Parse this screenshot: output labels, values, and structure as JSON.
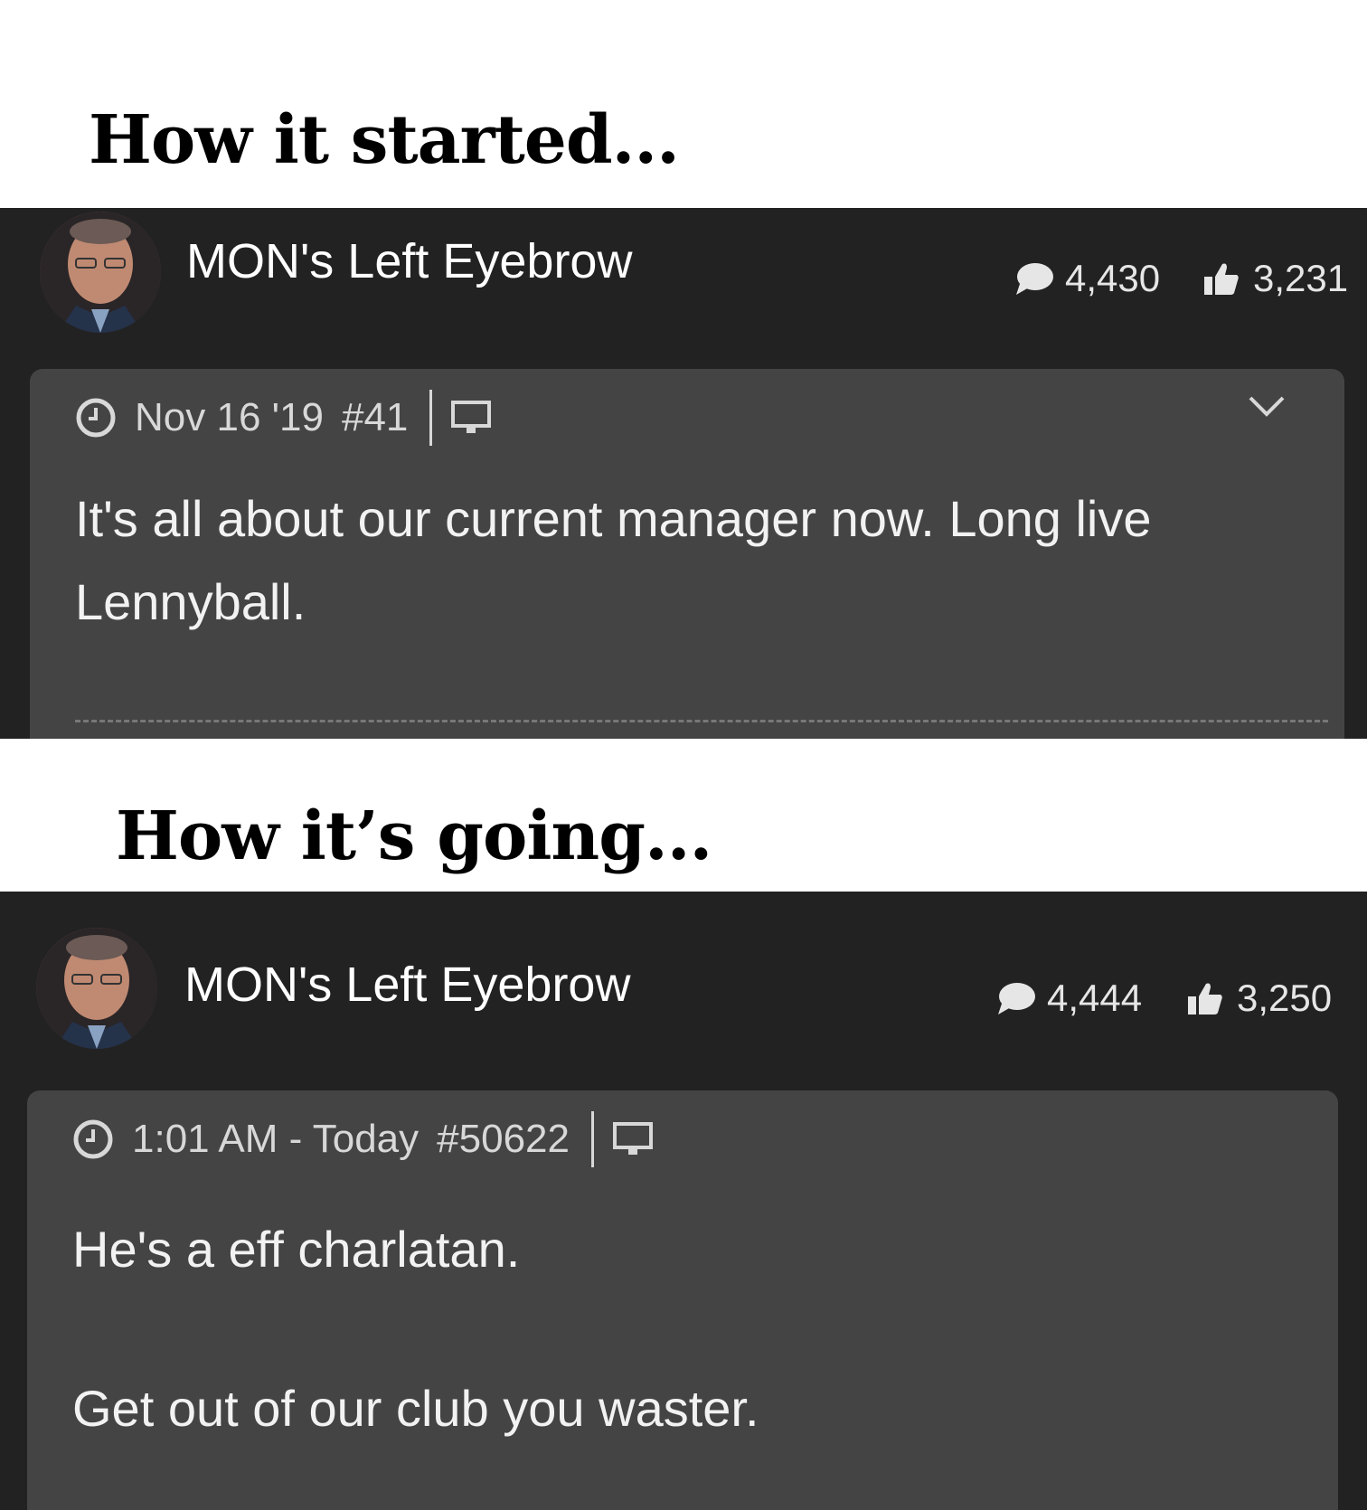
{
  "captions": {
    "started": "How it started...",
    "going": "How it’s going..."
  },
  "posts": [
    {
      "username": "MON's Left Eyebrow",
      "comments": "4,430",
      "likes": "3,231",
      "timestamp": "Nov 16 '19",
      "post_number": "#41",
      "body": [
        "It's all about our current manager now. Long live",
        "Lennyball."
      ]
    },
    {
      "username": "MON's Left Eyebrow",
      "comments": "4,444",
      "likes": "3,250",
      "timestamp": "1:01 AM - Today",
      "post_number": "#50622",
      "body": [
        "He's a eff charlatan.",
        "",
        "Get out of our club you waster."
      ]
    }
  ],
  "icons": {
    "avatar": "avatar",
    "comment": "speech-bubble-icon",
    "like": "thumbs-up-icon",
    "clock": "clock-icon",
    "device": "desktop-icon",
    "expand": "chevron-down-icon"
  }
}
